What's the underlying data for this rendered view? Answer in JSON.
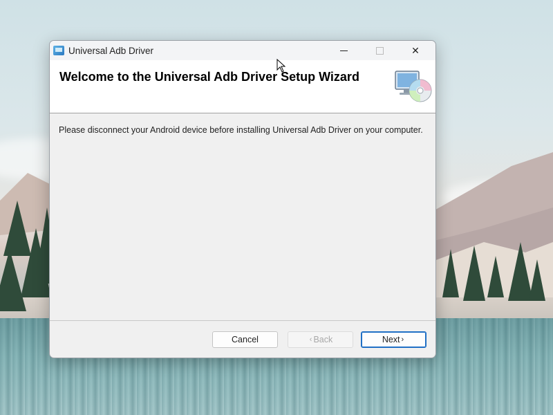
{
  "window": {
    "title": "Universal Adb Driver",
    "minimize_glyph": "",
    "close_glyph": "✕"
  },
  "banner": {
    "heading": "Welcome to the Universal Adb Driver Setup Wizard",
    "icon": "computer-disc-icon"
  },
  "body": {
    "message": "Please disconnect your Android device before installing Universal Adb Driver on your computer."
  },
  "buttons": {
    "cancel": "Cancel",
    "back": "Back",
    "back_chevron": "‹",
    "next": "Next",
    "next_chevron": "›",
    "back_enabled": false
  },
  "colors": {
    "accent": "#1f6fc5",
    "window_bg": "#f0f0f0",
    "banner_bg": "#ffffff"
  }
}
